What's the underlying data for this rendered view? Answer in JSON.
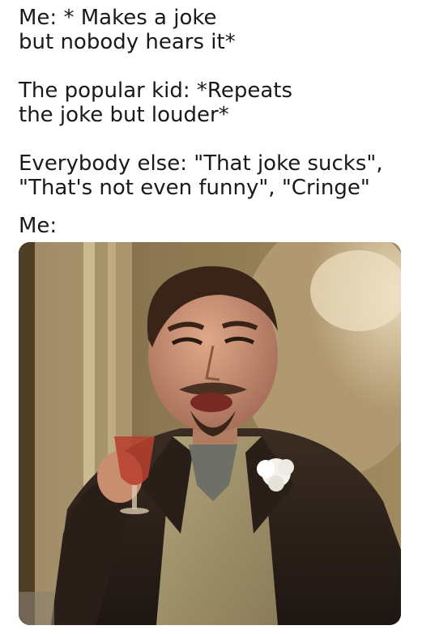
{
  "captions": [
    {
      "lines": [
        "Me: * Makes a joke",
        "but nobody hears it*"
      ]
    },
    {
      "lines": [
        "The popular kid: *Repeats",
        "the joke but louder*"
      ]
    },
    {
      "lines": [
        "Everybody else: \"That joke sucks\",",
        "\"That's not even funny\", \"Cringe\""
      ]
    },
    {
      "lines": [
        "Me:"
      ]
    }
  ]
}
